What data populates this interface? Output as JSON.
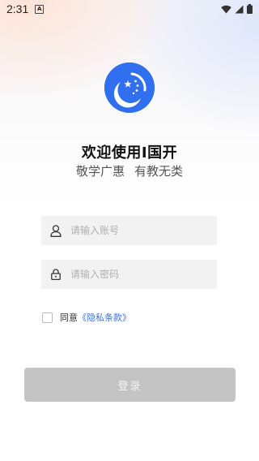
{
  "status_bar": {
    "time": "2:31",
    "notification_badge": "A",
    "icons": [
      "wifi-icon",
      "signal-icon",
      "battery-icon"
    ]
  },
  "brand": {
    "logo_icon": "moon-stars-logo-icon",
    "title": "欢迎使用I国开",
    "slogan_left": "敬学广惠",
    "slogan_right": "有教无类",
    "color": "#2f6ff0"
  },
  "form": {
    "account": {
      "icon": "user-icon",
      "placeholder": "请输入账号",
      "value": ""
    },
    "password": {
      "icon": "lock-icon",
      "placeholder": "请输入密码",
      "value": ""
    },
    "agreement": {
      "checked": false,
      "prefix": "同意",
      "link": "《隐私条款》",
      "link_color": "#3b6fd9"
    },
    "login_label": "登录"
  }
}
